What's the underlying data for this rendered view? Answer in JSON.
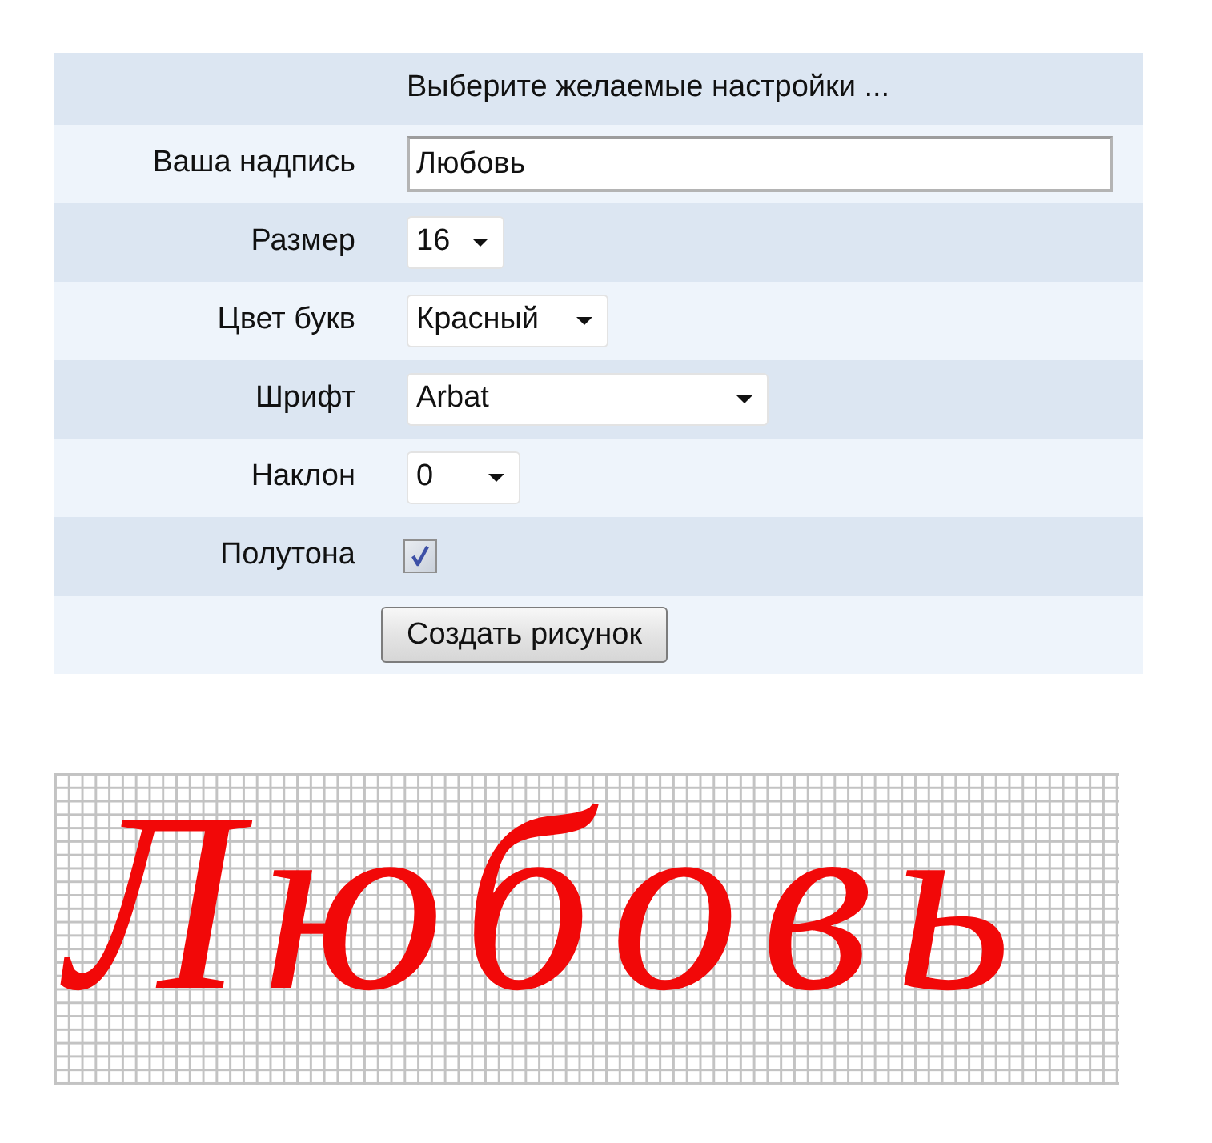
{
  "header": {
    "text": "Выберите желаемые настройки ..."
  },
  "fields": [
    {
      "kind": "text",
      "label": "Ваша надпись",
      "value": "Любовь"
    },
    {
      "kind": "select",
      "label": "Размер",
      "value": "16"
    },
    {
      "kind": "select",
      "label": "Цвет букв",
      "value": "Красный"
    },
    {
      "kind": "select",
      "label": "Шрифт",
      "value": "Arbat"
    },
    {
      "kind": "select",
      "label": "Наклон",
      "value": "0"
    },
    {
      "kind": "checkbox",
      "label": "Полутона",
      "checked": true
    }
  ],
  "submit_button": {
    "label": "Создать рисунок"
  },
  "preview": {
    "text": "Любовь"
  }
}
